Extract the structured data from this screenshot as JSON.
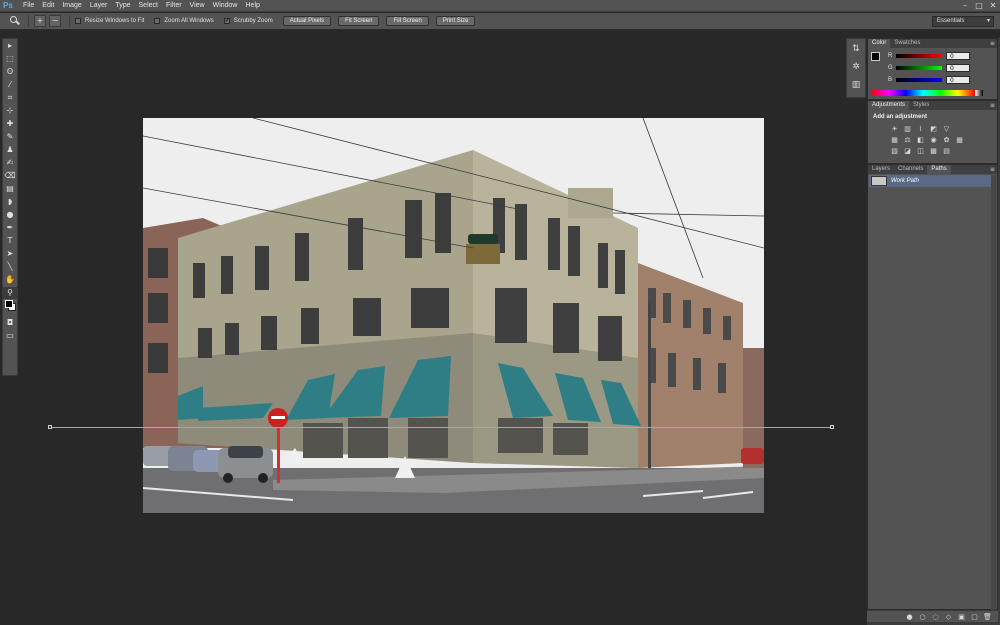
{
  "app": {
    "logo": "Ps"
  },
  "menu": [
    "File",
    "Edit",
    "Image",
    "Layer",
    "Type",
    "Select",
    "Filter",
    "View",
    "Window",
    "Help"
  ],
  "window_controls": {
    "minimize": "–",
    "maximize": "□",
    "close": "✕"
  },
  "options_bar": {
    "zoom_in": "+",
    "zoom_out": "−",
    "resize_windows": {
      "label": "Resize Windows to Fit",
      "checked": false
    },
    "zoom_all_windows": {
      "label": "Zoom All Windows",
      "checked": false
    },
    "scrubby_zoom": {
      "label": "Scrubby Zoom",
      "checked": true
    },
    "buttons": [
      "Actual Pixels",
      "Fit Screen",
      "Fill Screen",
      "Print Size"
    ],
    "workspace": "Essentials"
  },
  "tools": [
    "▸",
    "⬚",
    "ʘ",
    "⁄",
    "⌗",
    "⊹",
    "✚",
    "✎",
    "♟",
    "✍",
    "⌫",
    "▤",
    "◗",
    "●",
    "✒",
    "T",
    "➤",
    "╲",
    "✋",
    "⚲"
  ],
  "color_panel": {
    "tabs": [
      "Color",
      "Swatches"
    ],
    "channels": [
      {
        "label": "R",
        "value": "0",
        "gradient": [
          "#000000",
          "#ff0000"
        ]
      },
      {
        "label": "G",
        "value": "0",
        "gradient": [
          "#000000",
          "#00ff00"
        ]
      },
      {
        "label": "B",
        "value": "0",
        "gradient": [
          "#000000",
          "#0000ff"
        ]
      }
    ]
  },
  "adjustments_panel": {
    "tabs": [
      "Adjustments",
      "Styles"
    ],
    "title": "Add an adjustment",
    "icons": [
      "☀",
      "▥",
      "⌇",
      "◩",
      "▽",
      "",
      "▦",
      "⚖",
      "◧",
      "◉",
      "✿",
      "▦",
      "▨",
      "◪",
      "◫",
      "▩",
      "▤",
      ""
    ]
  },
  "layers_panel": {
    "tabs": [
      "Layers",
      "Channels",
      "Paths"
    ],
    "paths": [
      {
        "name": "Work Path"
      }
    ],
    "footer_icons": [
      "●",
      "○",
      "◌",
      "◇",
      "▣",
      "▢",
      "🗑"
    ]
  },
  "dock_icons": [
    "⇅",
    "✲",
    "▥"
  ]
}
